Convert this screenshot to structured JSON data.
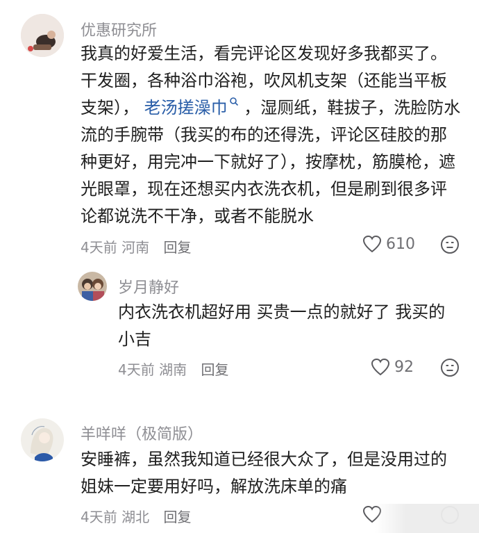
{
  "comments": [
    {
      "username": "优惠研究所",
      "lines": [
        "我真的好爱生活，看完评论区发现好多我都买了。",
        "干发圈，各种浴巾浴袍，吹风机支架（还能当平板",
        "流的手腕带（我买的布的还得洗，评论区硅胶的那",
        "种更好，用完冲一下就好了），按摩枕，筋膜枪，遮",
        "光眼罩，现在还想买内衣洗衣机，但是刷到很多评",
        "论都说洗不干净，或者不能脱水"
      ],
      "line3": {
        "prefix": "支架），",
        "link": "老汤搓澡巾",
        "suffix": "，湿厕纸，鞋拔子，洗脸防水"
      },
      "time": "4天前",
      "location": "河南",
      "reply_label": "回复",
      "likes": "610"
    },
    {
      "username": "岁月静好",
      "lines": [
        "内衣洗衣机超好用 买贵一点的就好了 我买的",
        "小吉"
      ],
      "time": "4天前",
      "location": "湖南",
      "reply_label": "回复",
      "likes": "92"
    },
    {
      "username": "羊咩咩（极简版）",
      "lines": [
        "安睡裤，虽然我知道已经很大众了，但是没用过的",
        "姐妹一定要用好吗，解放洗床单的痛"
      ],
      "time": "4天前",
      "location": "湖北",
      "reply_label": "回复",
      "likes": ""
    }
  ],
  "icons": {
    "like": "heart-outline-icon",
    "emoji": "neutral-face-icon",
    "link_search": "search-icon"
  },
  "colors": {
    "link": "#2a5ea8",
    "meta": "#8e8e93"
  }
}
